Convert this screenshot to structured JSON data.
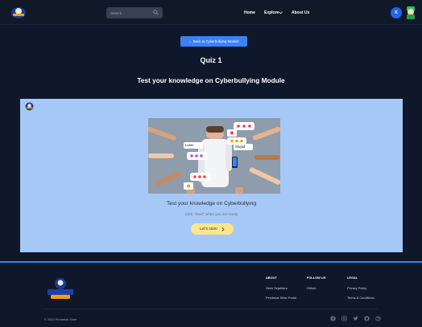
{
  "nav": {
    "search_placeholder": "Search...",
    "links": [
      "Home",
      "Explore",
      "About Us"
    ],
    "avatar_initial": "K"
  },
  "header": {
    "back_label": "← Back to Cyberbullying Module",
    "quiz_title": "Quiz 1",
    "quiz_subtitle": "Test your knowledge on Cyberbullying Module"
  },
  "card": {
    "illustration_labels": [
      "Loser",
      "Stupid"
    ],
    "heading": "Test your knowledge on Cyberbullying",
    "hint": "Click \"Start\" when you are ready",
    "start_label": "Let's start!"
  },
  "footer": {
    "brand": "PENDEKAR SIBER",
    "columns": [
      {
        "title": "ABOUT",
        "links": [
          "Siber Sejahtera",
          "Pendekar Siber Portal"
        ]
      },
      {
        "title": "FOLLOW US",
        "links": [
          "Github"
        ]
      },
      {
        "title": "LEGAL",
        "links": [
          "Privacy Policy",
          "Terms & Conditions"
        ]
      }
    ],
    "copyright": "© 2024 Pendekar Siber",
    "social_icons": [
      "facebook-icon",
      "instagram-icon",
      "twitter-icon",
      "github-icon",
      "dribbble-icon"
    ]
  },
  "colors": {
    "background": "#0f172a",
    "accent": "#3b82f6",
    "card_bg": "#a6c8f7",
    "start_button": "#fde68a"
  }
}
